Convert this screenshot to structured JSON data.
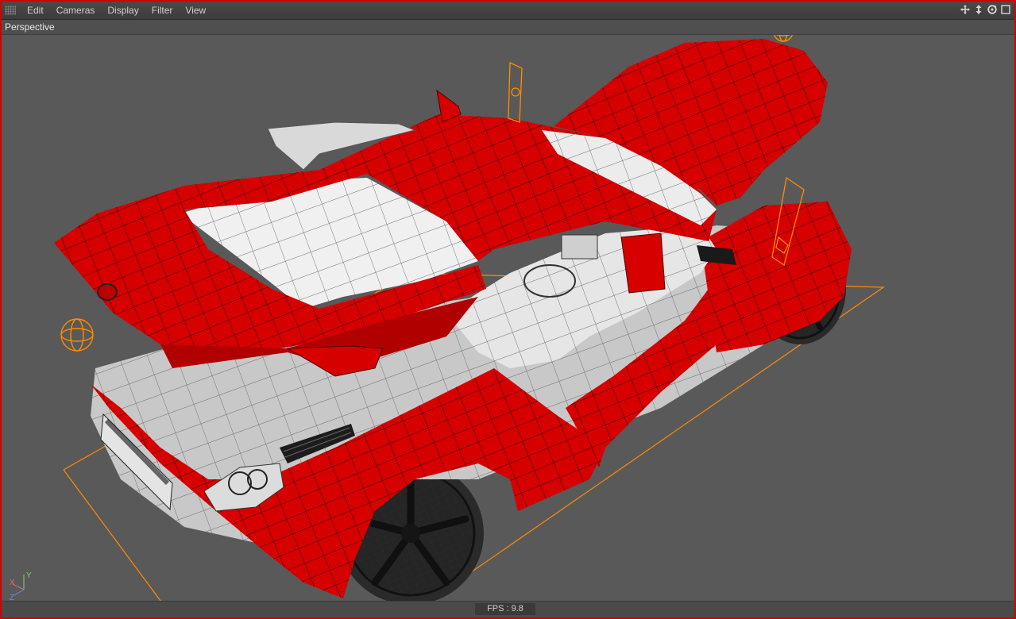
{
  "menu": {
    "items": [
      {
        "label": "Edit"
      },
      {
        "label": "Cameras"
      },
      {
        "label": "Display"
      },
      {
        "label": "Filter"
      },
      {
        "label": "View"
      }
    ]
  },
  "nav_icons": [
    "move-view-icon",
    "dolly-view-icon",
    "rotate-view-icon",
    "maximize-view-icon"
  ],
  "viewport": {
    "camera_label": "Perspective",
    "object": "red sports car wireframe model"
  },
  "axis": {
    "x": "X",
    "y": "Y",
    "z": "Z"
  },
  "status": {
    "fps": "FPS : 9.8"
  },
  "colors": {
    "frame_border": "#d40000",
    "car_body": "#d60000",
    "selection_bbox": "#ff8c00",
    "viewport_bg": "#595959"
  }
}
